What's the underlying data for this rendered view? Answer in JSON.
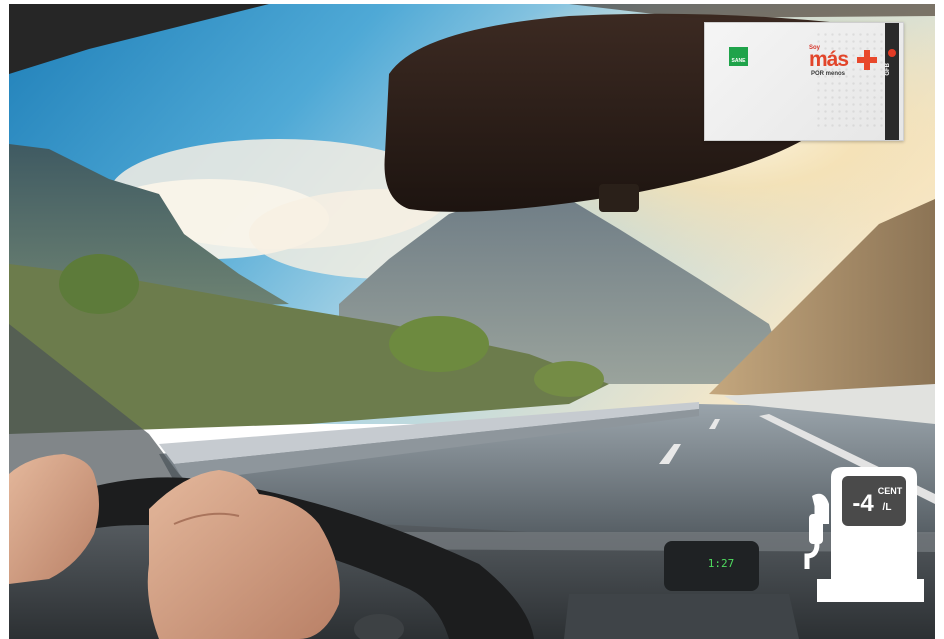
{
  "card": {
    "top_small": "Soy",
    "brand_text": "más",
    "bottom_small": "POR menos",
    "logo_small": "SANE",
    "stripe_text": "GFB"
  },
  "fuel_badge": {
    "value": "-4",
    "unit_top": "CENT",
    "unit_bottom": "/L"
  },
  "dashboard_clock": "1:27",
  "colors": {
    "brand_orange": "#e8482b",
    "card_green": "#1fa34a",
    "badge_white": "#ffffff",
    "badge_dark": "#4a4a4a"
  },
  "icons": [
    "fuel-pump-icon",
    "plus-icon"
  ]
}
